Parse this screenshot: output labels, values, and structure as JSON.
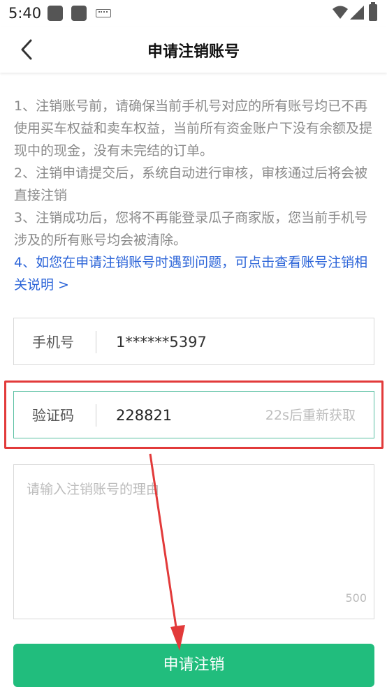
{
  "status_bar": {
    "time": "5:40",
    "icons": [
      "app-notification-icon",
      "app-notification-icon",
      "keyboard-icon",
      "wifi-icon",
      "signal-icon",
      "battery-icon"
    ]
  },
  "header": {
    "title": "申请注销账号",
    "back_icon": "chevron-left-icon"
  },
  "notice": {
    "item1": "1、注销账号前，请确保当前手机号对应的所有账号均已不再使用买车权益和卖车权益，当前所有资金账户下没有余额及提现中的现金，没有未完结的订单。",
    "item2": "2、注销申请提交后，系统自动进行审核，审核通过后将会被直接注销",
    "item3": "3、注销成功后，您将不再能登录瓜子商家版，您当前手机号涉及的所有账号均会被清除。",
    "item4": "4、如您在申请注销账号时遇到问题，可点击查看账号注销相关说明 >"
  },
  "form": {
    "phone_label": "手机号",
    "phone_value": "1******5397",
    "code_label": "验证码",
    "code_value": "228821",
    "code_countdown": "22s后重新获取",
    "reason_placeholder": "请输入注销账号的理由",
    "reason_limit": "500"
  },
  "submit_label": "申请注销",
  "colors": {
    "accent": "#21bd7d",
    "link": "#2a63d8",
    "highlight": "#e23a3a",
    "focus_border": "#5bc0a3"
  }
}
